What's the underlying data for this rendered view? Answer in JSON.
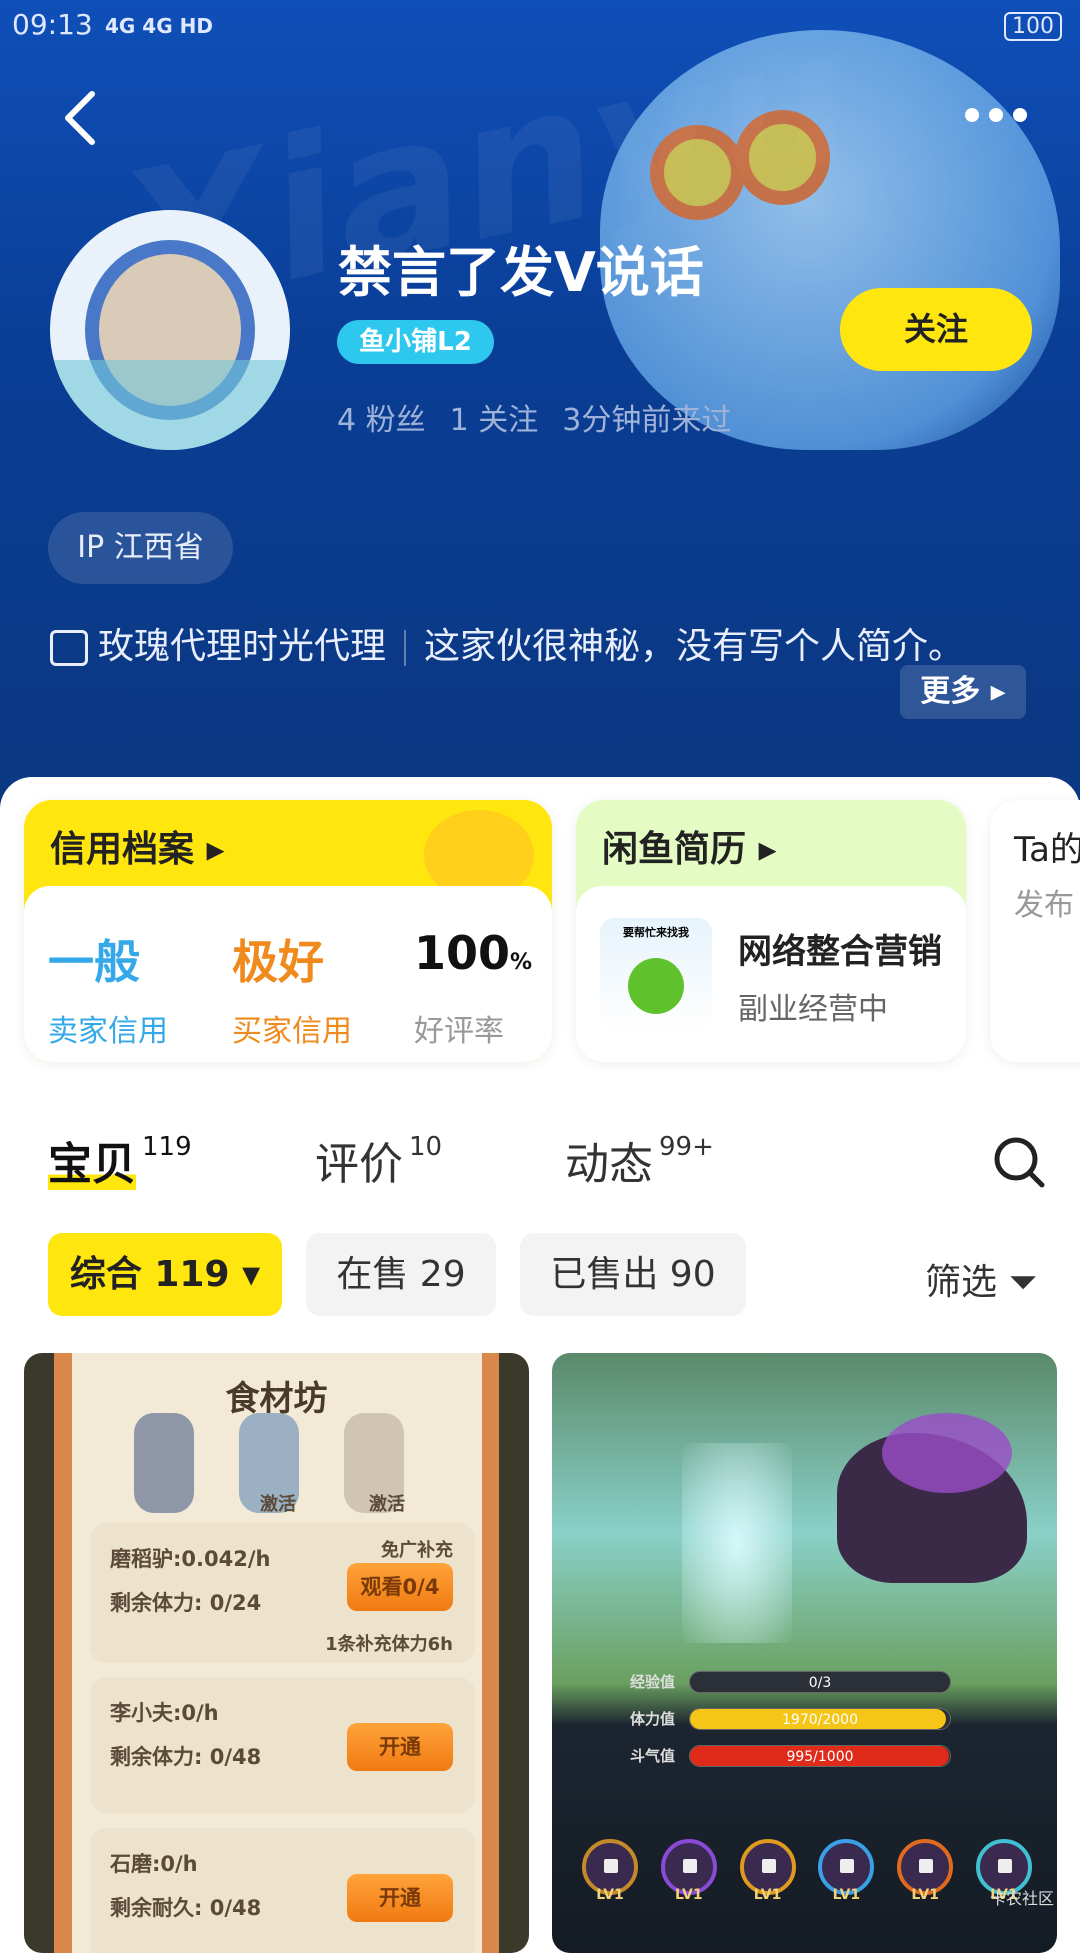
{
  "status_bar": {
    "time": "09:13",
    "network": "4G 4G HD",
    "battery": "100"
  },
  "header": {
    "watermark": "Xianyu",
    "back": "back-icon",
    "more": "more-icon"
  },
  "profile": {
    "name": "禁言了发V说话",
    "badge": "鱼小铺L2",
    "follow_label": "关注",
    "stats": [
      "4 粉丝",
      "1 关注",
      "3分钟前来过"
    ],
    "ip": "IP 江西省",
    "shop_name": "玫瑰代理时光代理",
    "bio": "这家伙很神秘，没有写个人简介。",
    "more_label": "更多"
  },
  "cards": {
    "credit": {
      "title": "信用档案",
      "items": [
        {
          "value": "一般",
          "label": "卖家信用",
          "color": "#34a8e8"
        },
        {
          "value": "极好",
          "label": "买家信用",
          "color": "#f08a1c"
        },
        {
          "value": "100",
          "unit": "%",
          "label": "好评率",
          "color": "#111111"
        }
      ]
    },
    "resume": {
      "title": "闲鱼简历",
      "thumb_text": "要帮忙来找我",
      "name": "网络整合营销",
      "sub": "副业经营中"
    },
    "third": {
      "title": "Ta的",
      "sub": "发布"
    }
  },
  "tabs": [
    {
      "label": "宝贝",
      "count": "119",
      "active": true
    },
    {
      "label": "评价",
      "count": "10"
    },
    {
      "label": "动态",
      "count": "99+"
    }
  ],
  "filters": {
    "chips": [
      {
        "label": "综合 119",
        "active": true
      },
      {
        "label": "在售 29"
      },
      {
        "label": "已售出 90"
      }
    ],
    "filter_label": "筛选"
  },
  "products": [
    {
      "title": "食材坊",
      "rows": [
        {
          "l1": "磨稻驴:0.042/h",
          "l2": "剩余体力: 0/24",
          "btn": "观看0/4",
          "note": "免广补充",
          "foot": "1条补充体力6h"
        },
        {
          "l1": "李小夫:0/h",
          "l2": "剩余体力: 0/48",
          "btn": "开通"
        },
        {
          "l1": "石磨:0/h",
          "l2": "剩余耐久: 0/48",
          "btn": "开通"
        }
      ],
      "activate": "激活"
    },
    {
      "bars": [
        {
          "label": "经验值",
          "value": "0/3",
          "fill": 0
        },
        {
          "label": "体力值",
          "value": "1970/2000",
          "fill": 0.985
        },
        {
          "label": "斗气值",
          "value": "995/1000",
          "fill": 0.995
        }
      ],
      "skill_level": "LV1"
    }
  ],
  "watermark": "卡农社区",
  "colors": {
    "accent": "#ffe60f",
    "hero": "#0b3d94"
  }
}
